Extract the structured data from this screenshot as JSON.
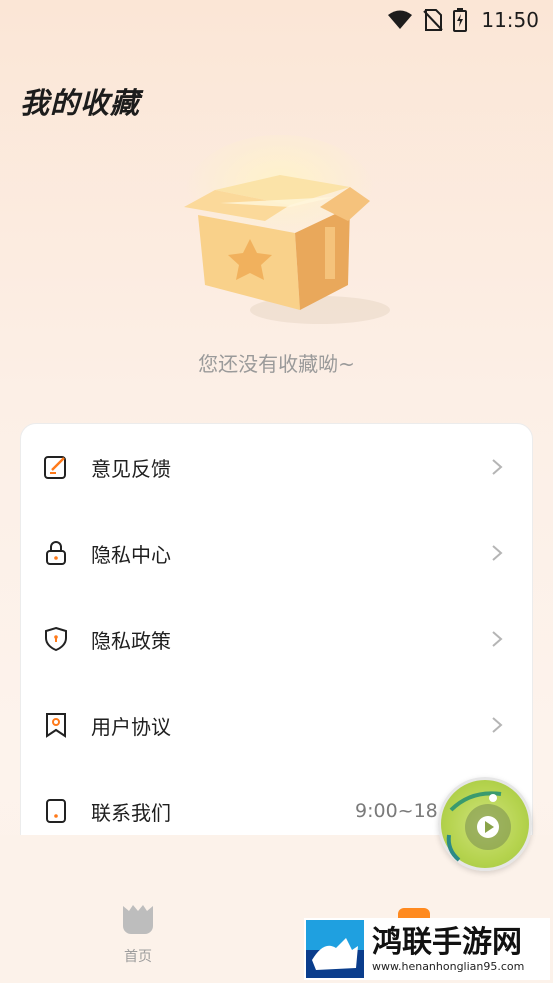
{
  "status_bar": {
    "time": "11:50"
  },
  "page": {
    "title": "我的收藏"
  },
  "empty_state": {
    "message": "您还没有收藏呦~"
  },
  "menu": {
    "items": [
      {
        "label": "意见反馈",
        "icon": "feedback-edit-icon"
      },
      {
        "label": "隐私中心",
        "icon": "lock-icon"
      },
      {
        "label": "隐私政策",
        "icon": "shield-icon"
      },
      {
        "label": "用户协议",
        "icon": "bookmark-icon"
      },
      {
        "label": "联系我们",
        "icon": "phone-icon",
        "value": "9:00~18"
      }
    ]
  },
  "tab_bar": {
    "home_label": "首页"
  },
  "watermark": {
    "title": "鸿联手游网",
    "url": "www.henanhonglian95.com"
  },
  "colors": {
    "accent": "#ff8a1f",
    "background": "#fcf2ea",
    "card": "#ffffff"
  }
}
